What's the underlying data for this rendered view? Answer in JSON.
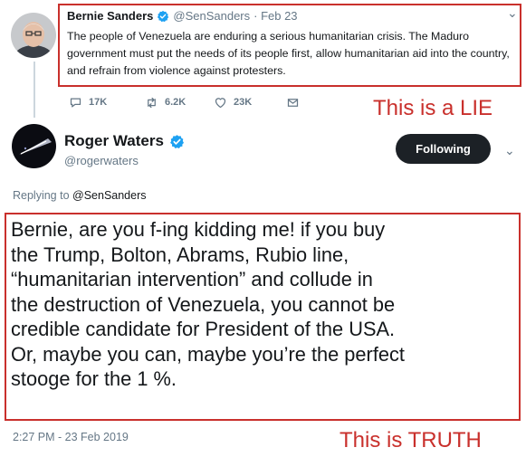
{
  "original_tweet": {
    "author_name": "Bernie Sanders",
    "handle": "@SenSanders",
    "meta": "· Feb 23",
    "text": "The people of Venezuela are enduring a serious humanitarian crisis. The Maduro government must put the needs of its people first, allow humanitarian aid into the country, and refrain from violence against protesters.",
    "counts": {
      "replies": "17K",
      "retweets": "6.2K",
      "likes": "23K"
    }
  },
  "annotations": {
    "lie_label": "This is a LIE",
    "truth_label": "This is TRUTH"
  },
  "reply_tweet": {
    "author_name": "Roger Waters",
    "handle": "@rogerwaters",
    "follow_label": "Following",
    "replying_prefix": "Replying to ",
    "replying_handle": "@SenSanders",
    "text": "Bernie, are you f-ing kidding me! if you buy\nthe Trump, Bolton, Abrams, Rubio line,\n“humanitarian intervention” and collude in\nthe destruction of Venezuela, you cannot be\ncredible candidate for President of the USA.\nOr, maybe you can, maybe you’re the perfect\nstooge for the 1 %.",
    "timestamp": "2:27 PM - 23 Feb 2019"
  },
  "icons": [
    "verified-badge-icon",
    "reply-icon",
    "retweet-icon",
    "like-icon",
    "message-icon",
    "chevron-down-icon"
  ],
  "colors": {
    "annotation_red": "#c9302c",
    "verified_blue": "#1da1f2",
    "muted_gray": "#657786",
    "button_dark": "#1c2126"
  }
}
